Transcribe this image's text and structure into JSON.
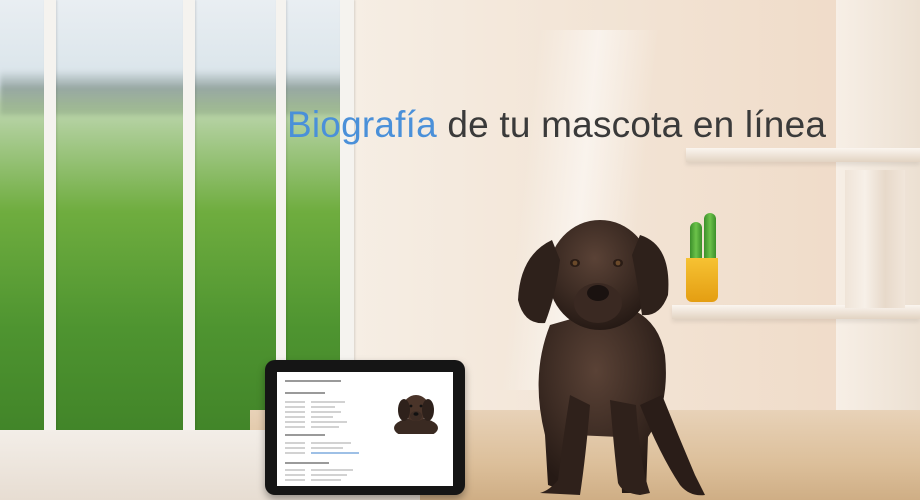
{
  "headline": {
    "accent": "Biografía",
    "rest": "de tu mascota en línea"
  },
  "colors": {
    "accent": "#4a90d9",
    "headline_text": "#3a3a3a",
    "puppy": "#3a2a22"
  },
  "icons": {
    "tablet": "tablet-device",
    "puppy": "labrador-puppy",
    "plant": "potted-cactus"
  }
}
